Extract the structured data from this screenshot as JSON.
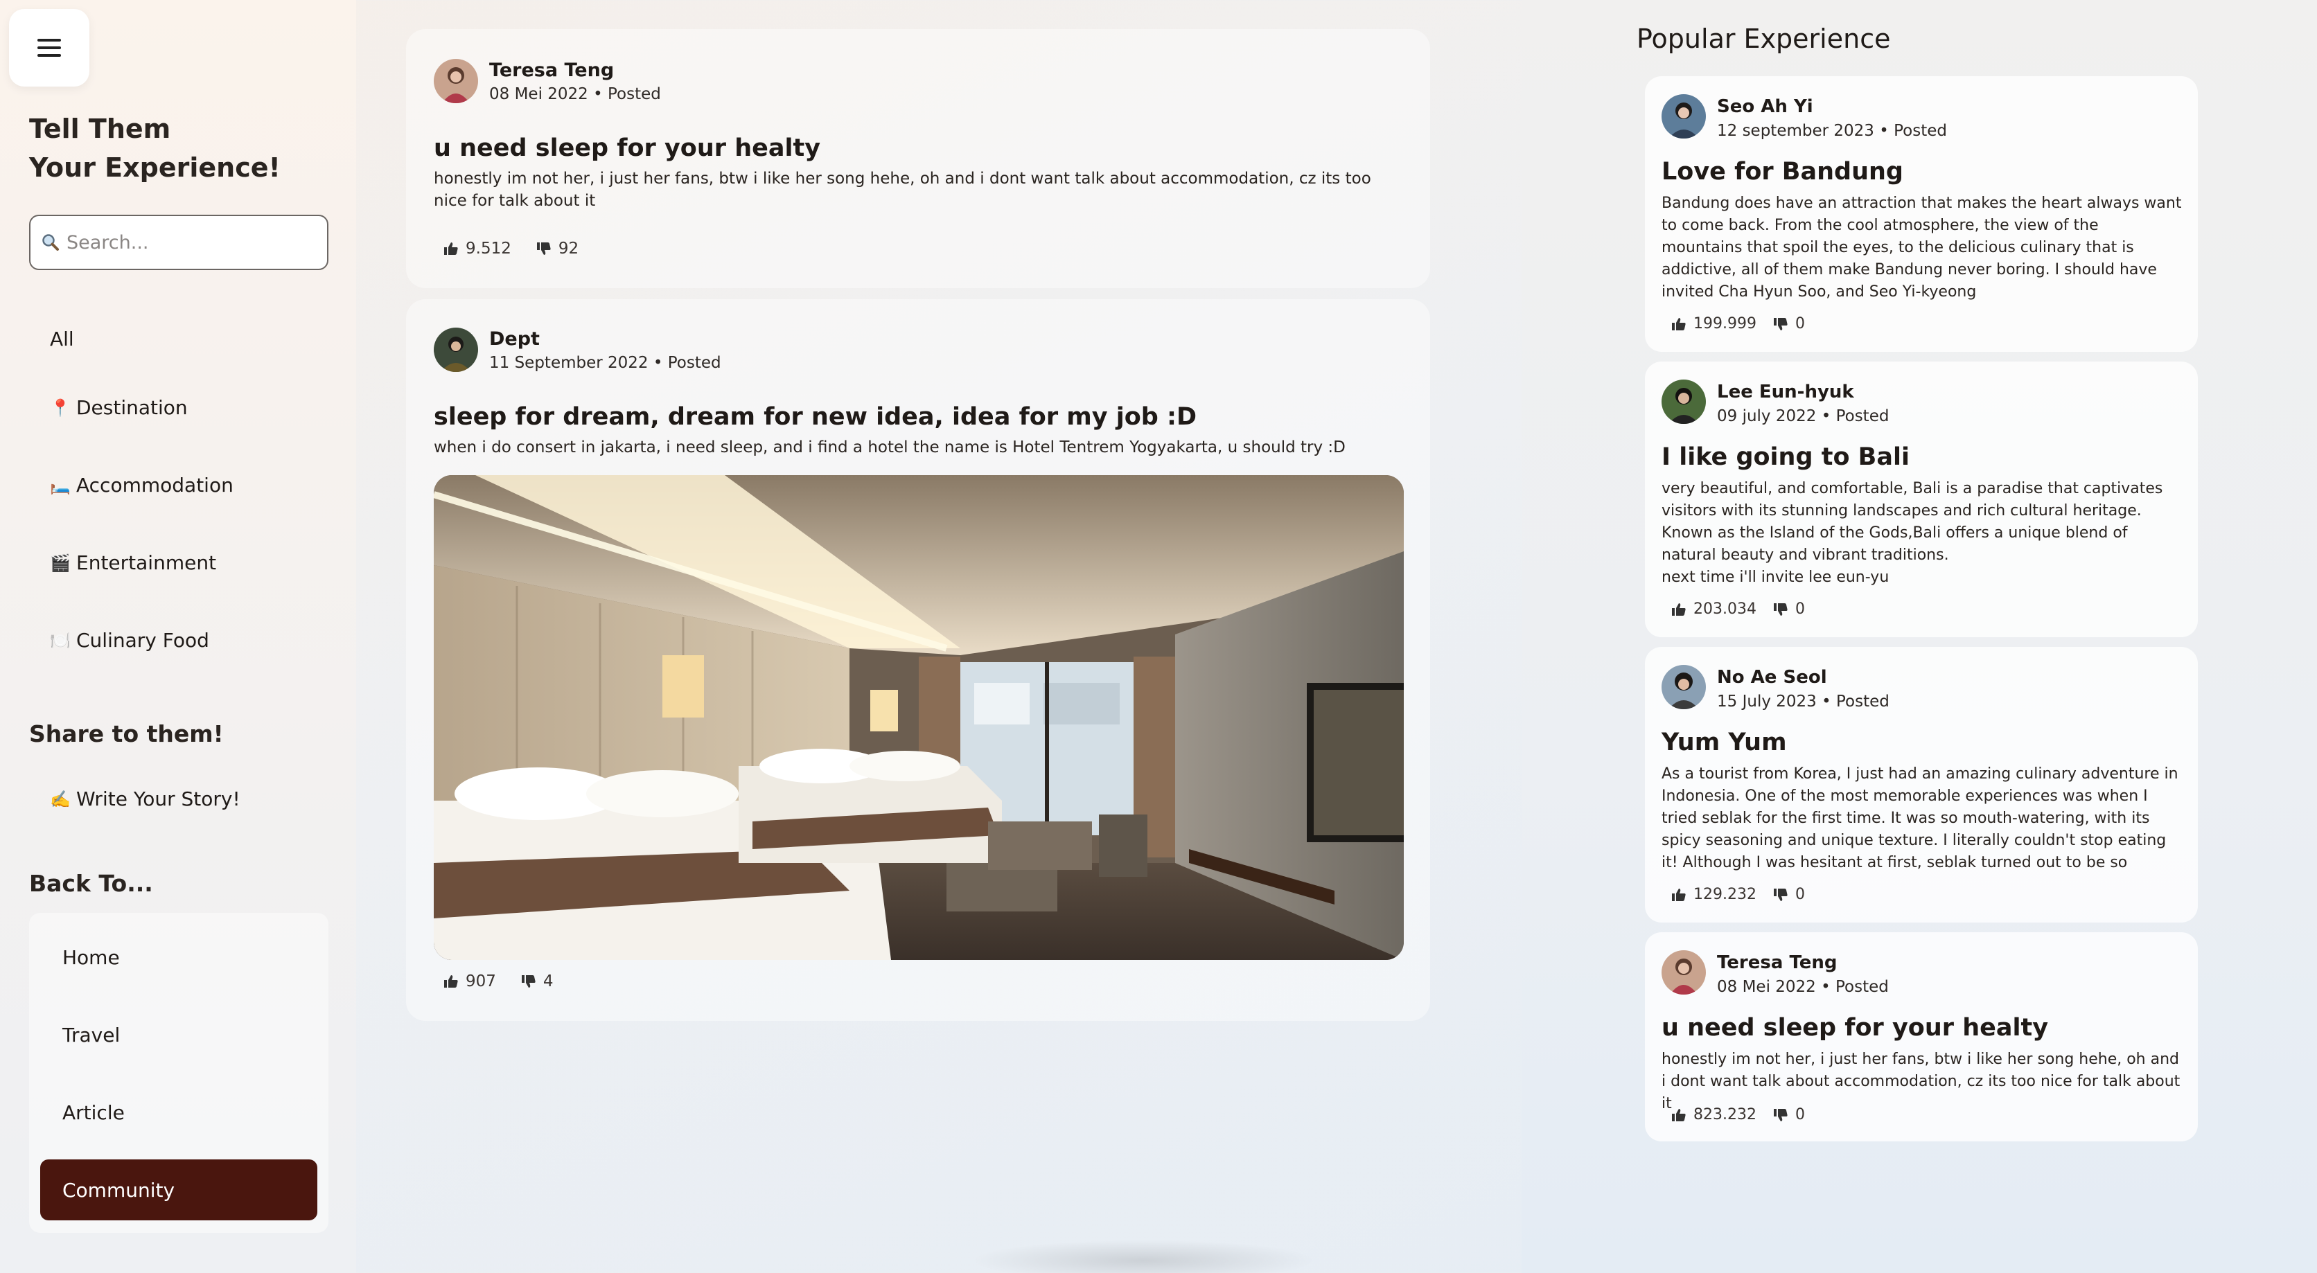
{
  "sidebar": {
    "menu_icon": "hamburger-menu-icon",
    "title_line1": "Tell Them",
    "title_line2": "Your Experience!",
    "search": {
      "placeholder": "Search...",
      "icon": "magnifier-icon"
    },
    "categories": [
      {
        "label": "All",
        "icon": ""
      },
      {
        "label": "Destination",
        "icon": "📍"
      },
      {
        "label": "Accommodation",
        "icon": "🛏️"
      },
      {
        "label": "Entertainment",
        "icon": "🎬"
      },
      {
        "label": "Culinary Food",
        "icon": "🍽️"
      }
    ],
    "share_heading": "Share to them!",
    "write_story": {
      "label": "Write Your Story!",
      "icon": "✍️"
    },
    "back_heading": "Back To...",
    "back_items": [
      {
        "label": "Home",
        "active": false
      },
      {
        "label": "Travel",
        "active": false
      },
      {
        "label": "Article",
        "active": false
      },
      {
        "label": "Community",
        "active": true
      }
    ],
    "active_color": "#4a160e"
  },
  "feed": [
    {
      "author": "Teresa Teng",
      "date": "08 Mei 2022",
      "status": "Posted",
      "meta": "08 Mei 2022 • Posted",
      "title": "u need sleep for your healty",
      "body": "honestly im not her, i just her fans, btw i like her song hehe, oh and i dont want talk about accommodation, cz its too nice for talk about it",
      "likes": "9.512",
      "dislikes": "92"
    },
    {
      "author": "Dept",
      "date": "11 September 2022",
      "status": "Posted",
      "meta": "11 September 2022 • Posted",
      "title": "sleep for dream, dream for new idea, idea for my job :D",
      "body": "when i do consert in jakarta, i need sleep, and i find a hotel the name is Hotel Tentrem Yogyakarta, u should try :D",
      "image": "hotel-room-photo",
      "likes": "907",
      "dislikes": "4"
    }
  ],
  "popular": {
    "heading": "Popular Experience",
    "items": [
      {
        "author": "Seo Ah Yi",
        "meta": "12 september 2023 • Posted",
        "title": "Love for Bandung",
        "body": "Bandung does have an attraction that makes the heart always want to come back. From the cool atmosphere, the view of the mountains that spoil the eyes, to the delicious culinary that is addictive, all of them make Bandung never boring. I should have invited Cha Hyun Soo, and Seo Yi-kyeong",
        "likes": "199.999",
        "dislikes": "0"
      },
      {
        "author": "Lee Eun-hyuk",
        "meta": "09 july 2022 • Posted",
        "title": "I like going to Bali",
        "body": "very beautiful, and comfortable, Bali is a paradise that captivates visitors with its stunning landscapes and rich cultural heritage. Known as the Island of the Gods,Bali offers a unique blend of natural beauty and vibrant traditions.",
        "body2": "next time i'll invite lee eun-yu",
        "likes": "203.034",
        "dislikes": "0"
      },
      {
        "author": "No Ae Seol",
        "meta": "15 July 2023 • Posted",
        "title": "Yum Yum",
        "body": "As a tourist from Korea, I just had an amazing culinary adventure in Indonesia. One of the most memorable experiences was when I tried seblak for the first time. It was so mouth-watering, with its spicy seasoning and unique texture. I literally couldn't stop eating it! Although I was hesitant at first, seblak turned out to be so delicious...",
        "likes": "129.232",
        "dislikes": "0"
      },
      {
        "author": "Teresa Teng",
        "meta": "08 Mei 2022 • Posted",
        "title": "u need sleep for your healty",
        "body": "honestly im not her, i just her fans, btw i like her song hehe, oh and i dont want talk about accommodation, cz its too nice for talk about it",
        "likes": "823.232",
        "dislikes": "0"
      }
    ]
  },
  "icons": {
    "like": "thumbs-up-icon",
    "dislike": "thumbs-down-icon"
  }
}
